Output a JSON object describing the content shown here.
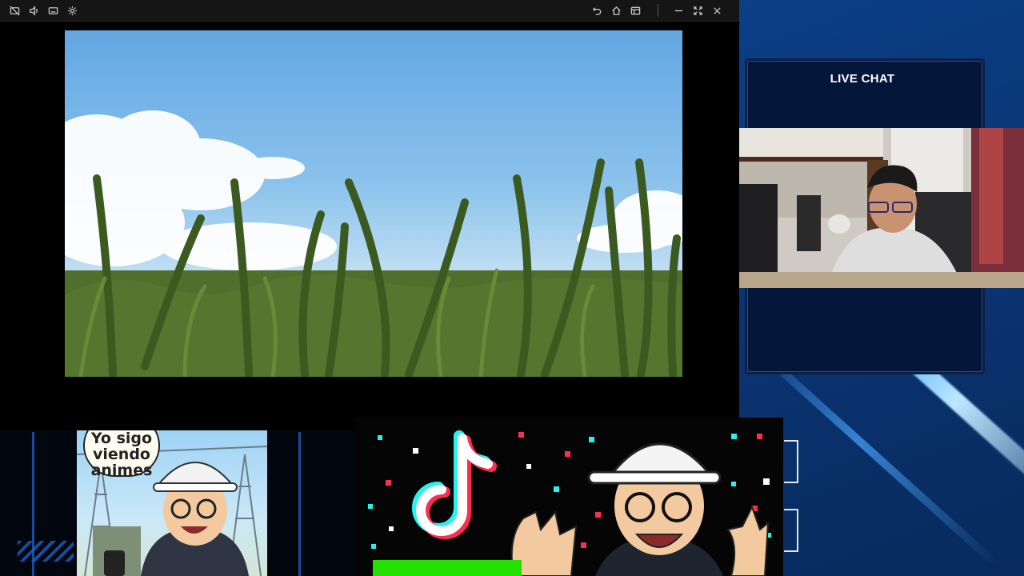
{
  "player": {
    "titlebar_left_icons": [
      "no-pip-icon",
      "volume-icon",
      "captions-icon",
      "settings-icon"
    ],
    "titlebar_right_icons": [
      "undo-icon",
      "home-icon",
      "layout-icon",
      "minimize-icon",
      "fullscreen-icon",
      "close-icon"
    ]
  },
  "chat": {
    "title": "LIVE CHAT"
  },
  "meme": {
    "line1": "Yo sigo",
    "line2": "viendo",
    "line3": "animes"
  },
  "colors": {
    "stream_blue": "#0b3f86",
    "beam": "#6fc3ff",
    "tiktok_cyan": "#25f4ee",
    "tiktok_red": "#fe2c55",
    "green_bar": "#22e000"
  }
}
